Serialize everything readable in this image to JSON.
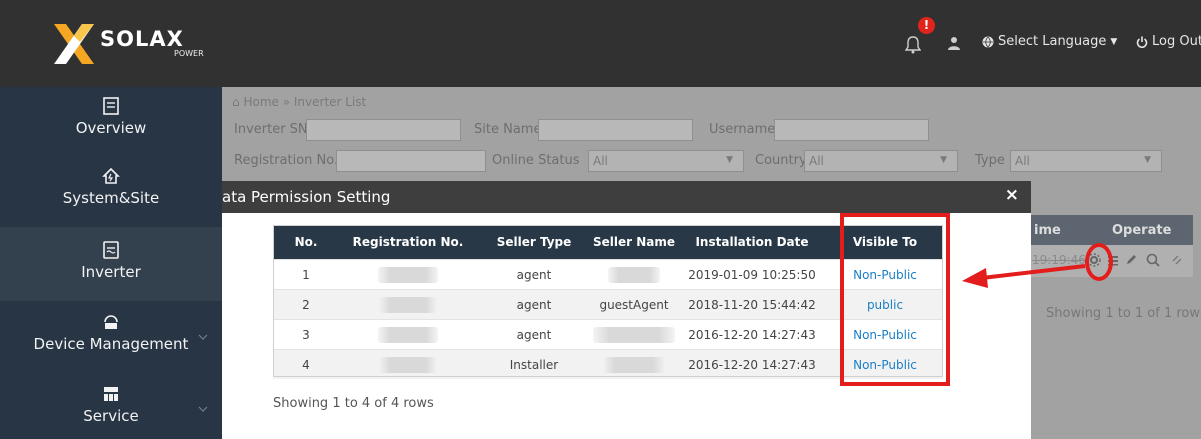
{
  "header": {
    "logo_text": "SOLAX",
    "logo_sub": "POWER",
    "notification_count": "!",
    "language_label": "Select Language",
    "logout_label": "Log Out"
  },
  "sidebar": {
    "items": [
      {
        "label": "Overview",
        "icon": "document-icon"
      },
      {
        "label": "System&Site",
        "icon": "home-icon"
      },
      {
        "label": "Inverter",
        "icon": "inverter-icon"
      },
      {
        "label": "Device Management",
        "icon": "device-icon"
      },
      {
        "label": "Service",
        "icon": "service-icon"
      }
    ]
  },
  "page": {
    "breadcrumb_home": "Home",
    "breadcrumb_sep": "»",
    "breadcrumb_current": "Inverter List",
    "filters": {
      "inverter_sn": "Inverter SN",
      "site_name": "Site Name",
      "username": "Username",
      "registration_no": "Registration No.",
      "online_status": "Online Status",
      "online_status_value": "All",
      "country": "Country",
      "country_value": "All",
      "type": "Type",
      "type_value": "All"
    },
    "bg_table": {
      "col_time": "ime",
      "col_operate": "Operate",
      "row_time": "19:19:46",
      "showing": "Showing 1 to 1 of 1 rows"
    }
  },
  "modal": {
    "title": "ata Permission Setting",
    "close_label": "×",
    "columns": [
      "No.",
      "Registration No.",
      "Seller Type",
      "Seller Name",
      "Installation Date",
      "Visible To"
    ],
    "rows": [
      {
        "no": "1",
        "seller_type": "agent",
        "seller_name": "",
        "installation_date": "2019-01-09 10:25:50",
        "visible_to": "Non-Public"
      },
      {
        "no": "2",
        "seller_type": "agent",
        "seller_name": "guestAgent",
        "installation_date": "2018-11-20 15:44:42",
        "visible_to": "public"
      },
      {
        "no": "3",
        "seller_type": "agent",
        "seller_name": "",
        "installation_date": "2016-12-20 14:27:43",
        "visible_to": "Non-Public"
      },
      {
        "no": "4",
        "seller_type": "Installer",
        "seller_name": "",
        "installation_date": "2016-12-20 14:27:43",
        "visible_to": "Non-Public"
      }
    ],
    "showing": "Showing 1 to 4 of 4 rows"
  },
  "colors": {
    "topbar": "#313131",
    "sidebar": "#273545",
    "table_header": "#283846",
    "link": "#1a7ec7",
    "highlight": "#e31c1c",
    "badge": "#e0241b"
  }
}
